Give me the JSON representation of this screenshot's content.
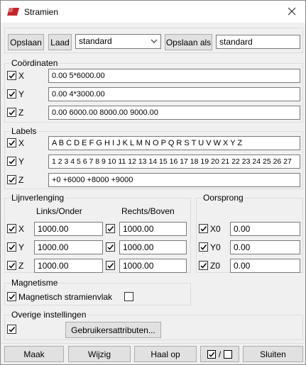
{
  "window": {
    "title": "Stramien"
  },
  "toolbar": {
    "save_label": "Opslaan",
    "load_label": "Laad",
    "preset_selected": "standard",
    "save_as_label": "Opslaan als",
    "save_as_value": "standard"
  },
  "coordinates": {
    "title": "Coördinaten",
    "rows": [
      {
        "axis": "X",
        "value": "0.00 5*6000.00"
      },
      {
        "axis": "Y",
        "value": "0.00 4*3000.00"
      },
      {
        "axis": "Z",
        "value": "0.00 6000.00 8000.00 9000.00"
      }
    ]
  },
  "labels": {
    "title": "Labels",
    "rows": [
      {
        "axis": "X",
        "value": "A B C D E F G H I J K L M N O P Q R S T U V W X Y Z"
      },
      {
        "axis": "Y",
        "value": "1 2 3 4 5 6 7 8 9 10 11 12 13 14 15 16 17 18 19 20 21 22 23 24 25 26 27"
      },
      {
        "axis": "Z",
        "value": "+0 +6000 +8000 +9000"
      }
    ]
  },
  "extension": {
    "title": "Lijnverlenging",
    "col_left": "Links/Onder",
    "col_right": "Rechts/Boven",
    "rows": [
      {
        "axis": "X",
        "left": "1000.00",
        "right": "1000.00"
      },
      {
        "axis": "Y",
        "left": "1000.00",
        "right": "1000.00"
      },
      {
        "axis": "Z",
        "left": "1000.00",
        "right": "1000.00"
      }
    ]
  },
  "origin": {
    "title": "Oorsprong",
    "rows": [
      {
        "axis": "X0",
        "value": "0.00"
      },
      {
        "axis": "Y0",
        "value": "0.00"
      },
      {
        "axis": "Z0",
        "value": "0.00"
      }
    ]
  },
  "magnetism": {
    "title": "Magnetisme",
    "label": "Magnetisch stramienvlak",
    "checked": false
  },
  "other": {
    "title": "Overige instellingen",
    "user_attr_label": "Gebruikersattributen..."
  },
  "footer": {
    "make_label": "Maak",
    "modify_label": "Wijzig",
    "fetch_label": "Haal op",
    "toggle_separator": "/",
    "close_label": "Sluiten"
  },
  "colors": {
    "accent": "#c0272d",
    "border": "#adadad",
    "background": "#f0f0f0"
  },
  "icons": {
    "app": "app-logo-icon",
    "close": "close-icon",
    "check": "check-icon",
    "chevron": "chevron-down-icon"
  }
}
